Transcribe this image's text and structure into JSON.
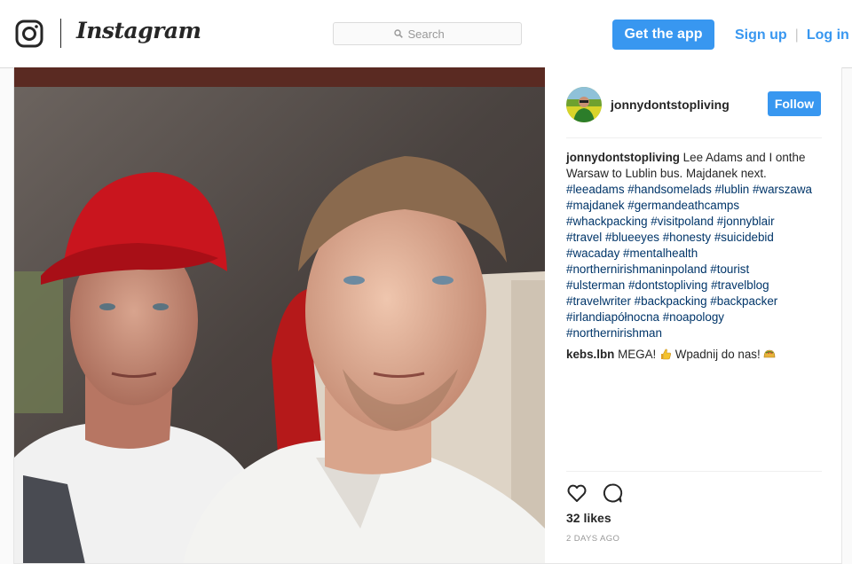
{
  "header": {
    "brand": "Instagram",
    "search_placeholder": "Search",
    "get_app_label": "Get the app",
    "sign_up_label": "Sign up",
    "separator": "|",
    "log_in_label": "Log in"
  },
  "colors": {
    "accent": "#3897f0",
    "hashtag": "#003569",
    "muted": "#999999",
    "text": "#262626"
  },
  "post": {
    "username": "jonnydontstopliving",
    "follow_label": "Follow",
    "caption": {
      "username": "jonnydontstopliving",
      "lines": [
        [
          {
            "t": "text",
            "v": "Lee Adams and I onthe"
          }
        ],
        [
          {
            "t": "text",
            "v": "Warsaw to Lublin bus. Majdanek next."
          }
        ],
        [
          {
            "t": "tag",
            "v": "#leeadams"
          },
          {
            "t": "tag",
            "v": "#handsomelads"
          },
          {
            "t": "tag",
            "v": "#lublin"
          },
          {
            "t": "tag",
            "v": "#warszawa"
          }
        ],
        [
          {
            "t": "tag",
            "v": "#majdanek"
          },
          {
            "t": "tag",
            "v": "#germandeathcamps"
          }
        ],
        [
          {
            "t": "tag",
            "v": "#whackpacking"
          },
          {
            "t": "tag",
            "v": "#visitpoland"
          },
          {
            "t": "tag",
            "v": "#jonnyblair"
          }
        ],
        [
          {
            "t": "tag",
            "v": "#travel"
          },
          {
            "t": "tag",
            "v": "#blueeyes"
          },
          {
            "t": "tag",
            "v": "#honesty"
          },
          {
            "t": "tag",
            "v": "#suicidebid"
          }
        ],
        [
          {
            "t": "tag",
            "v": "#wacaday"
          },
          {
            "t": "tag",
            "v": "#mentalhealth"
          }
        ],
        [
          {
            "t": "tag",
            "v": "#northernirishmaninpoland"
          },
          {
            "t": "tag",
            "v": "#tourist"
          }
        ],
        [
          {
            "t": "tag",
            "v": "#ulsterman"
          },
          {
            "t": "tag",
            "v": "#dontstopliving"
          },
          {
            "t": "tag",
            "v": "#travelblog"
          }
        ],
        [
          {
            "t": "tag",
            "v": "#travelwriter"
          },
          {
            "t": "tag",
            "v": "#backpacking"
          },
          {
            "t": "tag",
            "v": "#backpacker"
          }
        ],
        [
          {
            "t": "tag",
            "v": "#irlandiapółnocna"
          },
          {
            "t": "tag",
            "v": "#noapology"
          }
        ],
        [
          {
            "t": "tag",
            "v": "#northernirishman"
          }
        ]
      ]
    },
    "comments": [
      {
        "username": "kebs.lbn",
        "text_before": "MEGA!",
        "text_after": "Wpadnij do nas!",
        "emojis": [
          "thumbs-up-emoji",
          "taco-emoji"
        ]
      }
    ],
    "likes": "32 likes",
    "time_ago": "2 DAYS AGO",
    "icons": {
      "like": "heart-icon",
      "comment": "comment-icon",
      "search": "search-icon",
      "logo": "instagram-camera-icon"
    }
  }
}
